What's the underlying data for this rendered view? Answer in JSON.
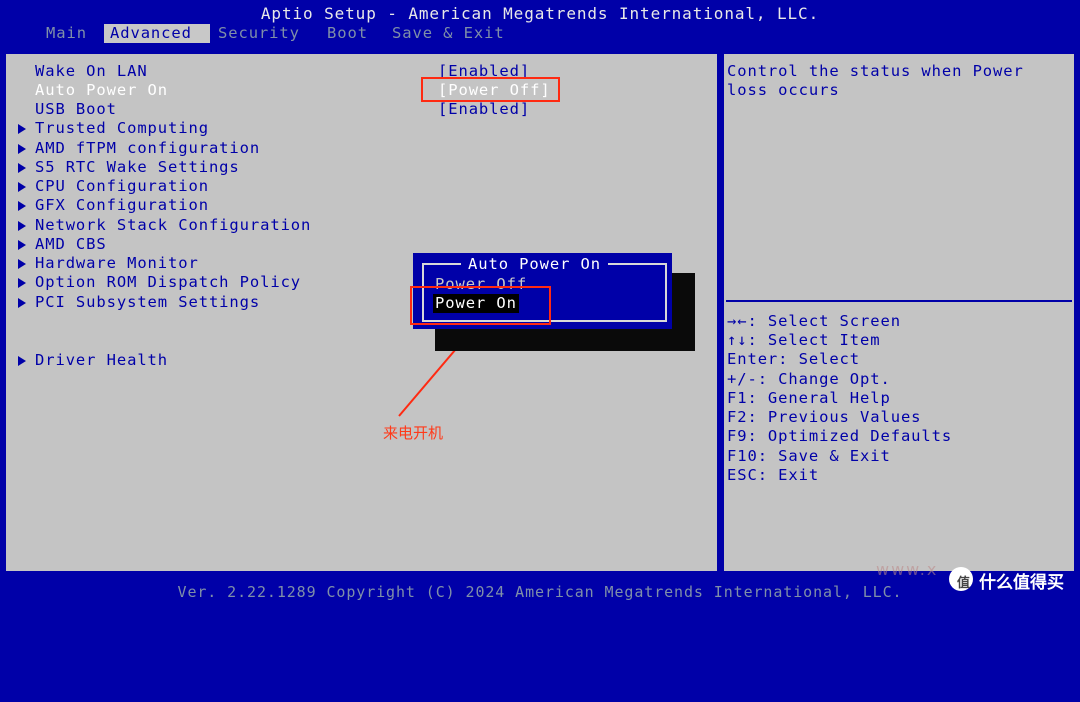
{
  "header": {
    "title": "Aptio Setup - American Megatrends International, LLC."
  },
  "tabs": [
    {
      "label": "Main"
    },
    {
      "label": "Advanced"
    },
    {
      "label": "Security"
    },
    {
      "label": "Boot"
    },
    {
      "label": "Save & Exit"
    }
  ],
  "settings": [
    {
      "label": "Wake On LAN",
      "value": "[Enabled]"
    },
    {
      "label": "Auto Power On",
      "value": "[Power Off]"
    },
    {
      "label": "USB Boot",
      "value": "[Enabled]"
    }
  ],
  "submenus": [
    {
      "label": "Trusted Computing"
    },
    {
      "label": "AMD fTPM configuration"
    },
    {
      "label": "S5 RTC Wake Settings"
    },
    {
      "label": "CPU Configuration"
    },
    {
      "label": "GFX Configuration"
    },
    {
      "label": "Network Stack Configuration"
    },
    {
      "label": "AMD CBS"
    },
    {
      "label": "Hardware Monitor"
    },
    {
      "label": "Option ROM Dispatch Policy"
    },
    {
      "label": "PCI Subsystem Settings"
    },
    {
      "label": "Driver Health"
    }
  ],
  "help": {
    "line1": "Control the status when Power",
    "line2": "loss occurs"
  },
  "keys": [
    {
      "text": "→←: Select Screen",
      "icon": "left-right-arrows"
    },
    {
      "text": "↑↓: Select Item",
      "icon": "up-down-arrows"
    },
    {
      "text": "Enter: Select"
    },
    {
      "text": "+/-: Change Opt."
    },
    {
      "text": "F1: General Help"
    },
    {
      "text": "F2: Previous Values"
    },
    {
      "text": "F9: Optimized Defaults"
    },
    {
      "text": "F10: Save & Exit"
    },
    {
      "text": "ESC: Exit"
    }
  ],
  "popup": {
    "title": "Auto Power On",
    "options": [
      "Power Off",
      "Power On"
    ],
    "selected": "Power On"
  },
  "annotation": {
    "text": "来电开机"
  },
  "footer": {
    "text": "Ver. 2.22.1289 Copyright (C) 2024 American Megatrends International, LLC."
  },
  "watermark": {
    "text": "什么值得买",
    "faint": "www.x"
  },
  "colors": {
    "bios_blue": "#0000a8",
    "panel_gray": "#c4c4c4",
    "annotation_red": "#ff2a12"
  }
}
